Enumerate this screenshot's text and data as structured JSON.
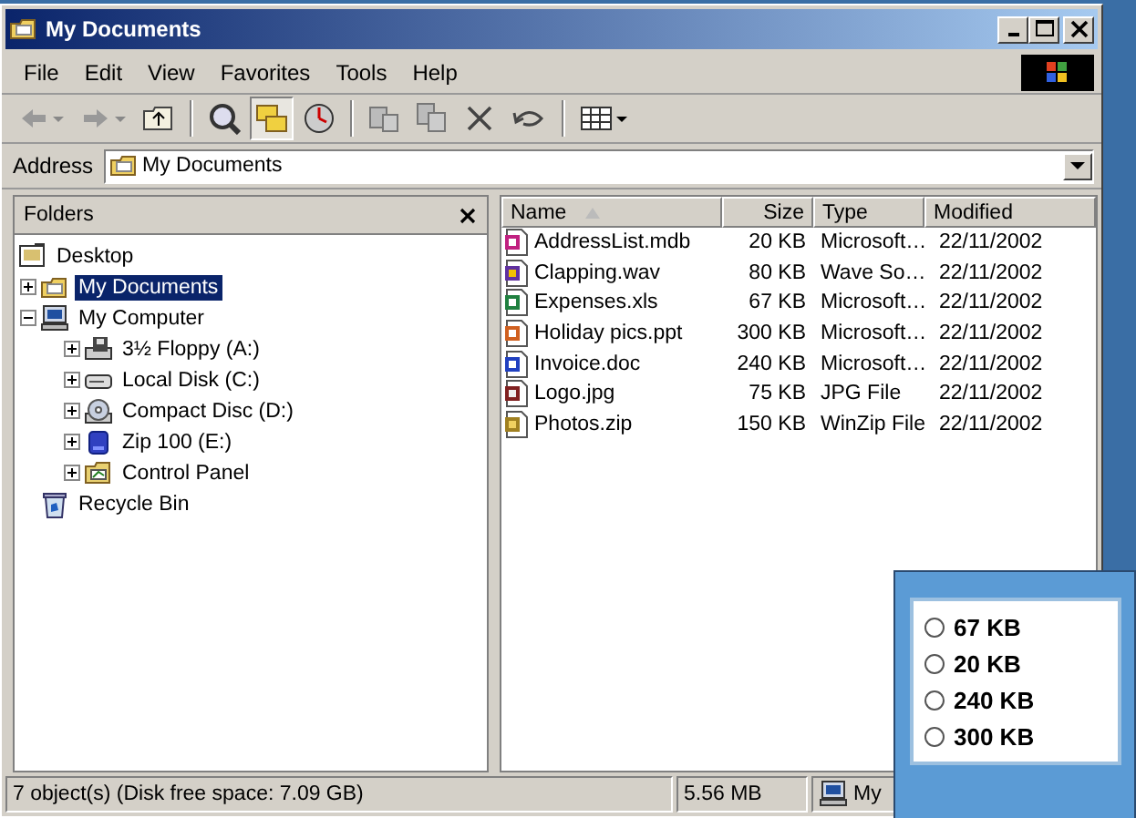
{
  "window": {
    "title": "My Documents"
  },
  "menu": [
    "File",
    "Edit",
    "View",
    "Favorites",
    "Tools",
    "Help"
  ],
  "address": {
    "label": "Address",
    "value": "My Documents"
  },
  "folders": {
    "title": "Folders",
    "tree": [
      {
        "label": "Desktop",
        "kind": "desktop",
        "selected": false,
        "children": [
          {
            "label": "My Documents",
            "kind": "documents",
            "selected": true,
            "expanded": false
          },
          {
            "label": "My Computer",
            "kind": "computer",
            "selected": false,
            "expanded": true,
            "children": [
              {
                "label": "3½ Floppy (A:)",
                "kind": "floppy",
                "selected": false,
                "expanded": false
              },
              {
                "label": "Local Disk (C:)",
                "kind": "disk",
                "selected": false,
                "expanded": false
              },
              {
                "label": "Compact Disc (D:)",
                "kind": "cd",
                "selected": false,
                "expanded": false
              },
              {
                "label": "Zip 100  (E:)",
                "kind": "zip",
                "selected": false,
                "expanded": false
              },
              {
                "label": "Control Panel",
                "kind": "control",
                "selected": false,
                "expanded": false
              }
            ]
          },
          {
            "label": "Recycle Bin",
            "kind": "recycle",
            "selected": false
          }
        ]
      }
    ]
  },
  "files": {
    "columns": [
      {
        "label": "Name",
        "sorted": true
      },
      {
        "label": "Size",
        "sorted": false
      },
      {
        "label": "Type",
        "sorted": false
      },
      {
        "label": "Modified",
        "sorted": false
      }
    ],
    "rows": [
      {
        "name": "AddressList.mdb",
        "size": "20 KB",
        "type": "Microsoft…",
        "modified": "22/11/2002",
        "kind": "mdb"
      },
      {
        "name": "Clapping.wav",
        "size": "80 KB",
        "type": "Wave So…",
        "modified": "22/11/2002",
        "kind": "wav"
      },
      {
        "name": "Expenses.xls",
        "size": "67 KB",
        "type": "Microsoft…",
        "modified": "22/11/2002",
        "kind": "xls"
      },
      {
        "name": "Holiday pics.ppt",
        "size": "300 KB",
        "type": "Microsoft…",
        "modified": "22/11/2002",
        "kind": "ppt"
      },
      {
        "name": "Invoice.doc",
        "size": "240 KB",
        "type": "Microsoft…",
        "modified": "22/11/2002",
        "kind": "doc"
      },
      {
        "name": "Logo.jpg",
        "size": "75 KB",
        "type": "JPG File",
        "modified": "22/11/2002",
        "kind": "jpg"
      },
      {
        "name": "Photos.zip",
        "size": "150 KB",
        "type": "WinZip File",
        "modified": "22/11/2002",
        "kind": "zip"
      }
    ]
  },
  "status_bar": {
    "objects": "7 object(s) (Disk free space: 7.09 GB)",
    "size": "5.56 MB",
    "location": "My"
  },
  "quiz": {
    "options": [
      {
        "label": "67 KB",
        "selected": false
      },
      {
        "label": "20 KB",
        "selected": false
      },
      {
        "label": "240 KB",
        "selected": false
      },
      {
        "label": "300 KB",
        "selected": false
      }
    ]
  }
}
